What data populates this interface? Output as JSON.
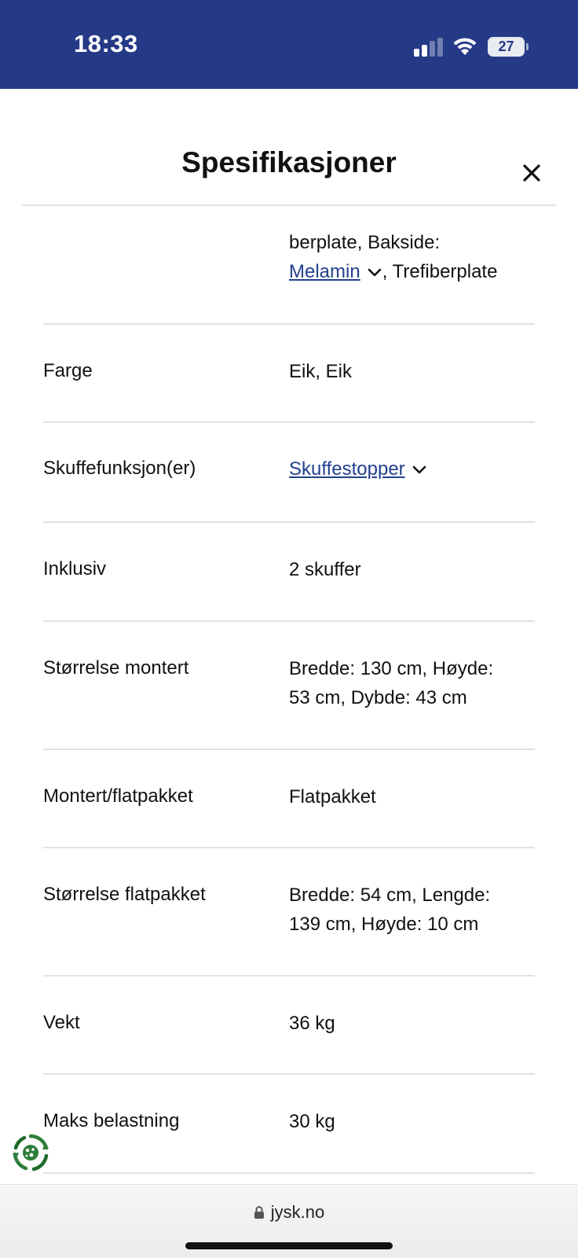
{
  "status_bar": {
    "time": "18:33",
    "battery_level": "27"
  },
  "modal": {
    "title": "Spesifikasjoner"
  },
  "specs": {
    "partial_row": {
      "line1": "berplate, Bakside:",
      "link": "Melamin",
      "rest": ", Trefiberplate"
    },
    "rows": [
      {
        "label": "Farge",
        "value": "Eik, Eik"
      },
      {
        "label": "Skuffefunksjon(er)",
        "link": "Skuffestopper"
      },
      {
        "label": "Inklusiv",
        "value": "2 skuffer"
      },
      {
        "label": "Størrelse montert",
        "value_line1": "Bredde: 130 cm, Høyde:",
        "value_line2": "53 cm, Dybde: 43 cm"
      },
      {
        "label": "Montert/flatpakket",
        "value": "Flatpakket"
      },
      {
        "label": "Størrelse flatpakket",
        "value_line1": "Bredde: 54 cm, Lengde:",
        "value_line2": "139 cm, Høyde: 10 cm"
      },
      {
        "label": "Vekt",
        "value": "36 kg"
      },
      {
        "label": "Maks belastning",
        "value": "30 kg"
      }
    ]
  },
  "browser": {
    "url": "jysk.no"
  },
  "colors": {
    "status_bar_bg": "#253a86",
    "link": "#23408f"
  }
}
